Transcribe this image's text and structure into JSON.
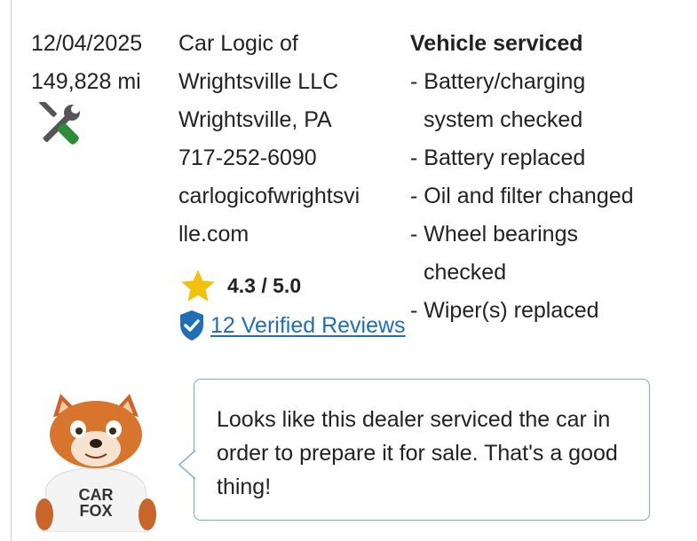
{
  "record": {
    "date": "12/04/2025",
    "mileage": "149,828 mi",
    "icon": "tools-icon"
  },
  "shop": {
    "name_line1": "Car Logic of",
    "name_line2": "Wrightsville LLC",
    "location": "Wrightsville, PA",
    "phone": "717-252-6090",
    "website_line1": "carlogicofwrightsvi",
    "website_line2": "lle.com",
    "rating": "4.3 / 5.0",
    "reviews_link": "12 Verified Reviews"
  },
  "service": {
    "title": "Vehicle serviced",
    "items": [
      "- Battery/charging",
      "system checked",
      "- Battery replaced",
      "- Oil and filter changed",
      "- Wheel bearings",
      "checked",
      "- Wiper(s) replaced"
    ]
  },
  "carfox": {
    "shirt_line1": "CAR",
    "shirt_line2": "FOX",
    "message": "Looks like this dealer serviced the car in order to prepare it for sale. That's a good thing!"
  },
  "colors": {
    "link": "#1f6fb6",
    "star": "#f2c10d",
    "shield": "#1f6fb6",
    "tool_green": "#2e8b3a",
    "bubble_border": "#7ea8cb"
  }
}
